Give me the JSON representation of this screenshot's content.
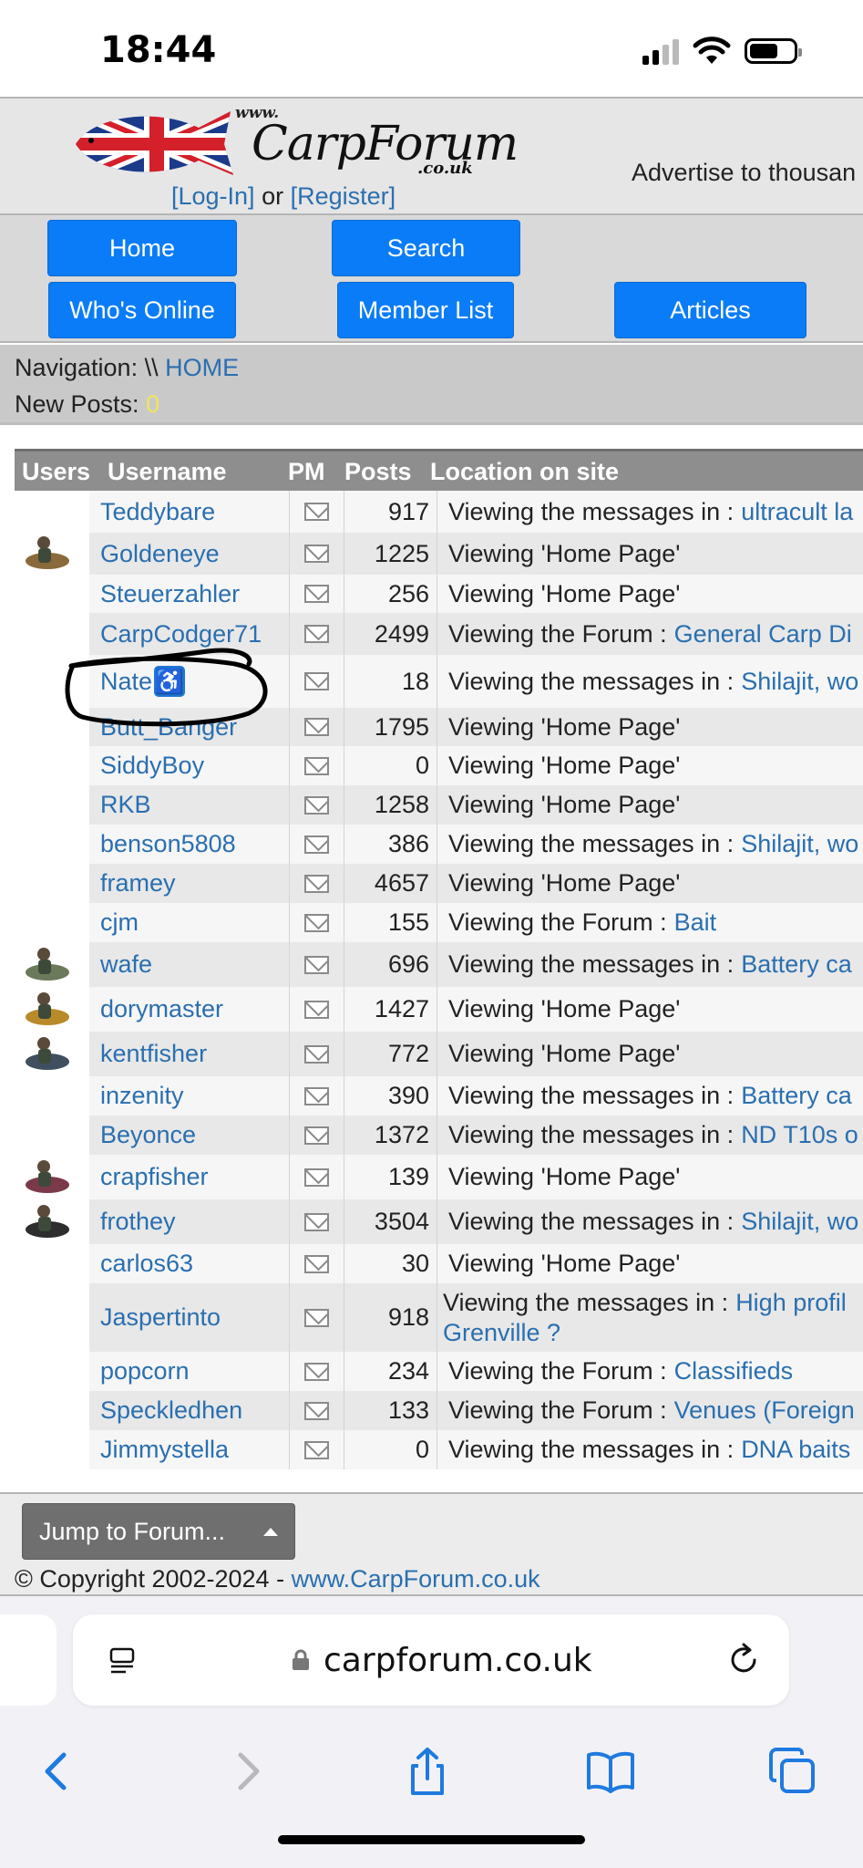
{
  "status_bar": {
    "time": "18:44"
  },
  "header": {
    "logo_www": "www.",
    "logo_name": "CarpForum",
    "logo_couk": ".co.uk",
    "login_label": "[Log-In]",
    "or_label": "or",
    "register_label": "[Register]",
    "advertise_text": "Advertise to thousan"
  },
  "nav_buttons": {
    "home": "Home",
    "search": "Search",
    "whos_online": "Who's Online",
    "member_list": "Member List",
    "articles": "Articles"
  },
  "navigation": {
    "label": "Navigation: \\\\",
    "home_link": "HOME",
    "new_posts_label": "New Posts:",
    "new_posts_count": "0"
  },
  "table": {
    "headers": {
      "users": "Users",
      "username": "Username",
      "pm": "PM",
      "posts": "Posts",
      "location": "Location on site"
    },
    "rows": [
      {
        "username": "Teddybare",
        "posts": "917",
        "location": "Viewing the messages in :",
        "link": "ultracult la"
      },
      {
        "username": "Goldeneye",
        "posts": "1225",
        "location": "Viewing 'Home Page'",
        "link": ""
      },
      {
        "username": "Steuerzahler",
        "posts": "256",
        "location": "Viewing 'Home Page'",
        "link": ""
      },
      {
        "username": "CarpCodger71",
        "posts": "2499",
        "location": "Viewing the Forum :",
        "link": "General Carp Di"
      },
      {
        "username": "Nate",
        "posts": "18",
        "location": "Viewing the messages in :",
        "link": "Shilajit, wo"
      },
      {
        "username": "Butt_Banger",
        "posts": "1795",
        "location": "Viewing 'Home Page'",
        "link": ""
      },
      {
        "username": "SiddyBoy",
        "posts": "0",
        "location": "Viewing 'Home Page'",
        "link": ""
      },
      {
        "username": "RKB",
        "posts": "1258",
        "location": "Viewing 'Home Page'",
        "link": ""
      },
      {
        "username": "benson5808",
        "posts": "386",
        "location": "Viewing the messages in :",
        "link": "Shilajit, wo"
      },
      {
        "username": "framey",
        "posts": "4657",
        "location": "Viewing 'Home Page'",
        "link": ""
      },
      {
        "username": "cjm",
        "posts": "155",
        "location": "Viewing the Forum :",
        "link": "Bait"
      },
      {
        "username": "wafe",
        "posts": "696",
        "location": "Viewing the messages in :",
        "link": "Battery ca"
      },
      {
        "username": "dorymaster",
        "posts": "1427",
        "location": "Viewing 'Home Page'",
        "link": ""
      },
      {
        "username": "kentfisher",
        "posts": "772",
        "location": "Viewing 'Home Page'",
        "link": ""
      },
      {
        "username": "inzenity",
        "posts": "390",
        "location": "Viewing the messages in :",
        "link": "Battery ca"
      },
      {
        "username": "Beyonce",
        "posts": "1372",
        "location": "Viewing the messages in :",
        "link": "ND T10s o"
      },
      {
        "username": "crapfisher",
        "posts": "139",
        "location": "Viewing 'Home Page'",
        "link": ""
      },
      {
        "username": "frothey",
        "posts": "3504",
        "location": "Viewing the messages in :",
        "link": "Shilajit, wo"
      },
      {
        "username": "carlos63",
        "posts": "30",
        "location": "Viewing 'Home Page'",
        "link": ""
      },
      {
        "username": "Jaspertinto",
        "posts": "918",
        "location": "Viewing the messages in :",
        "link": "High profil",
        "link2": "Grenville ?"
      },
      {
        "username": "popcorn",
        "posts": "234",
        "location": "Viewing the Forum :",
        "link": "Classifieds"
      },
      {
        "username": "Speckledhen",
        "posts": "133",
        "location": "Viewing the Forum :",
        "link": "Venues (Foreign"
      },
      {
        "username": "Jimmystella",
        "posts": "0",
        "location": "Viewing the messages in :",
        "link": "DNA baits"
      }
    ]
  },
  "footer": {
    "jump_label": "Jump to Forum...",
    "copyright": "© Copyright 2002-2024  -",
    "site_link": "www.CarpForum.co.uk"
  },
  "browser": {
    "url": "carpforum.co.uk"
  },
  "colors": {
    "button_blue": "#0b7cf7",
    "link_blue": "#2a6fb0",
    "header_gray": "#8e8e8e",
    "new_count_yellow": "#f2e55c"
  }
}
